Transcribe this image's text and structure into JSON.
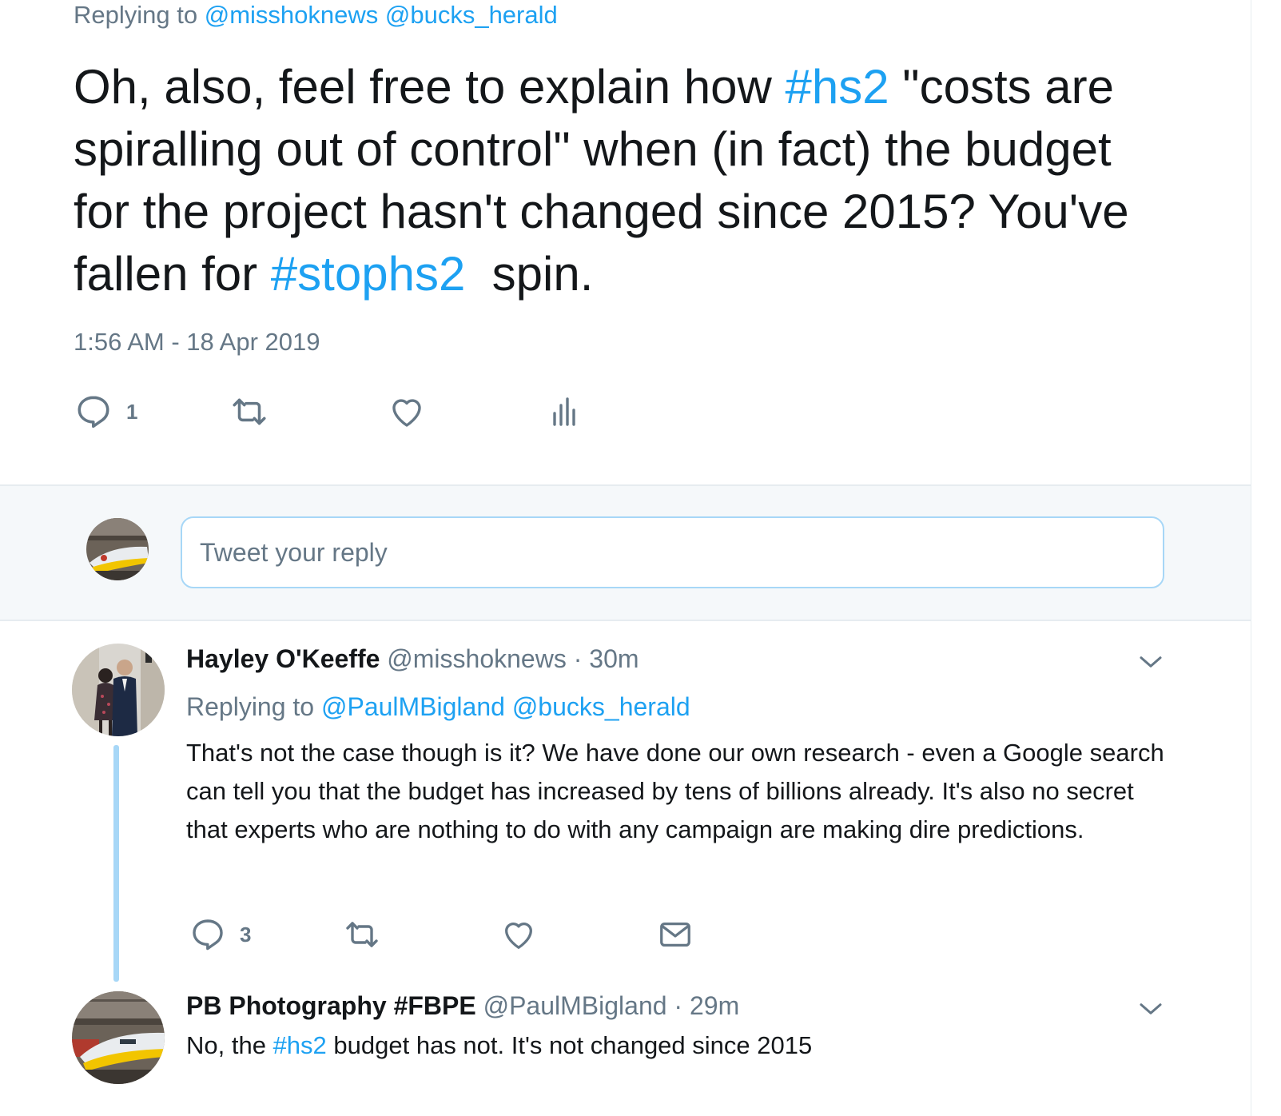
{
  "main_tweet": {
    "replying_prefix": "Replying to",
    "replying_handles": [
      "@misshoknews",
      "@bucks_herald"
    ],
    "text_parts": [
      {
        "text": "Oh, also, feel free to explain how ",
        "link": false
      },
      {
        "text": "#hs2",
        "link": true
      },
      {
        "text": " \"costs are spiralling out of control\" when (in fact) the budget for the project hasn't changed since 2015? You've fallen for ",
        "link": false
      },
      {
        "text": "#stophs2",
        "link": true
      },
      {
        "text": "  spin.",
        "link": false
      }
    ],
    "timestamp": "1:56 AM - 18 Apr 2019",
    "reply_count": "1",
    "actions": [
      "reply-icon",
      "retweet-icon",
      "heart-icon",
      "analytics-icon"
    ]
  },
  "composer": {
    "placeholder": "Tweet your reply"
  },
  "replies": [
    {
      "name": "Hayley O'Keeffe",
      "handle": "@misshoknews",
      "sep": " · ",
      "time": "30m",
      "replying_prefix": "Replying to",
      "replying_handles": [
        "@PaulMBigland",
        "@bucks_herald"
      ],
      "body": "That's not the case though is it? We have done our own research - even a Google search can tell you that the budget has increased by tens of billions already. It's also no secret that experts who are nothing to do with any campaign are making dire predictions.",
      "reply_count": "3",
      "actions": [
        "reply-icon",
        "retweet-icon",
        "heart-icon",
        "mail-icon"
      ]
    },
    {
      "name": "PB Photography #FBPE",
      "handle": "@PaulMBigland",
      "sep": " · ",
      "time": "29m",
      "body_parts": [
        {
          "text": "No, the ",
          "link": false
        },
        {
          "text": "#hs2",
          "link": true
        },
        {
          "text": " budget has not. It's not changed since 2015",
          "link": false
        }
      ]
    }
  ],
  "colors": {
    "link": "#1da1f2",
    "muted": "#657786",
    "text": "#14171a",
    "thread_line": "#a7d7f7",
    "composer_bg": "#f5f8fa"
  }
}
